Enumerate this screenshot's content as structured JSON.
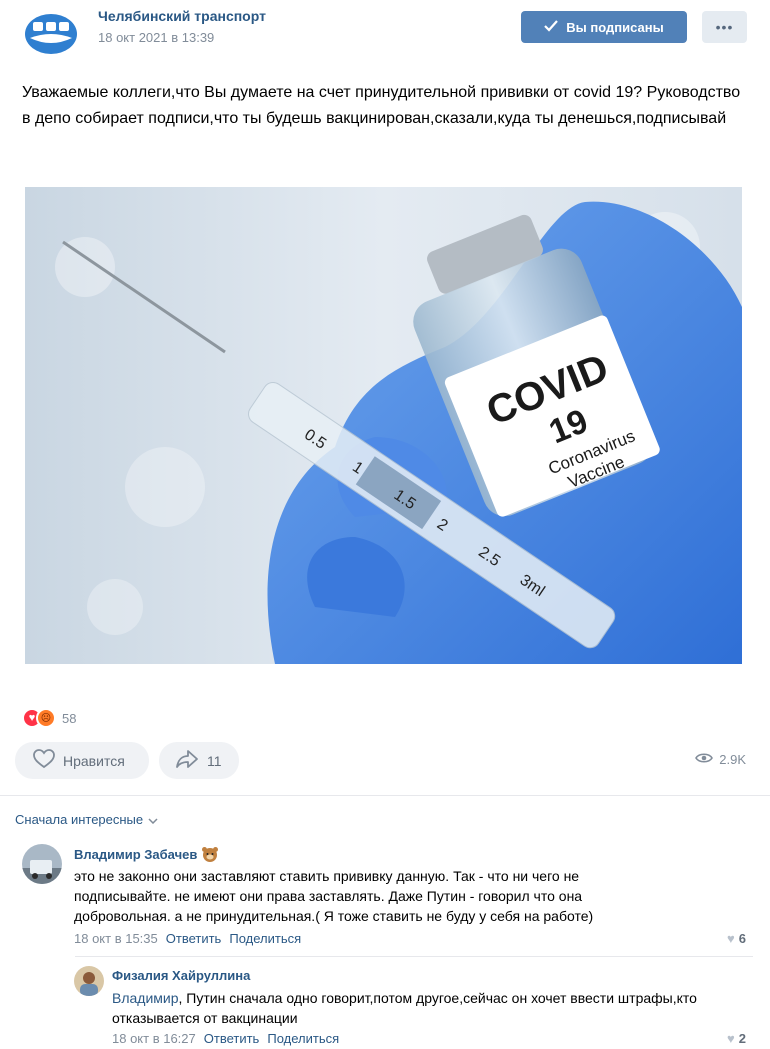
{
  "post": {
    "group_name": "Челябинский транспорт",
    "date": "18 окт 2021 в 13:39",
    "subscribed_label": "Вы подписаны",
    "more_label": "•••",
    "text": "Уважаемые коллеги,что Вы думаете на счет принудительной прививки от covid 19? Руководство в депо собирает подписи,что ты будешь вакцинирован,сказали,куда ты денешься,подписывай",
    "image_label": {
      "line1": "COVID",
      "line2": "19",
      "line3": "Coronavirus",
      "line4": "Vaccine"
    },
    "syringe_marks": [
      "0.5",
      "1",
      "1.5",
      "2",
      "2.5",
      "3ml"
    ],
    "reactions_count": "58",
    "like_label": "Нравится",
    "share_count": "11",
    "views": "2.9K"
  },
  "comments": {
    "sort_label": "Сначала интересные",
    "items": [
      {
        "author": "Владимир Забачев",
        "text": "это не законно они заставляют ставить прививку данную. Так - что ни чего не подписывайте. не имеют они права заставлять. Даже Путин - говорил что она добровольная. а не принудительная.( Я тоже ставить не буду у себя на работе)",
        "date": "18 окт в 15:35",
        "reply_label": "Ответить",
        "share_label": "Поделиться",
        "likes": "6"
      },
      {
        "author": "Физалия Хайруллина",
        "mention": "Владимир",
        "text": ", Путин сначала одно говорит,потом другое,сейчас он хочет ввести штрафы,кто отказывается от вакцинации",
        "date": "18 окт в 16:27",
        "reply_label": "Ответить",
        "share_label": "Поделиться",
        "likes": "2"
      }
    ]
  },
  "colors": {
    "link": "#2a5885",
    "accent_button": "#5181b8",
    "secondary_text": "#818c99"
  }
}
